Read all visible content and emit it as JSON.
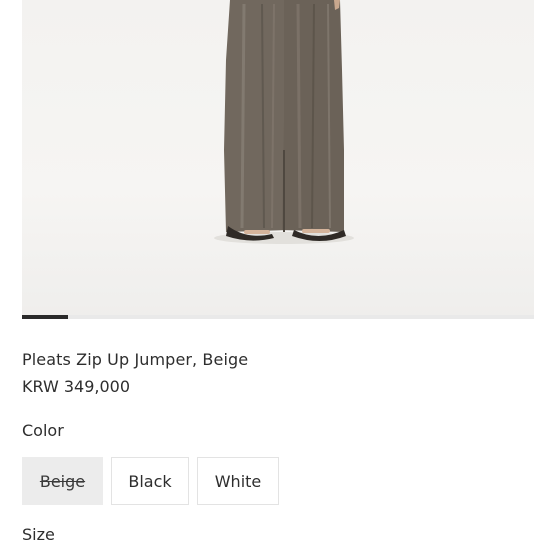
{
  "product": {
    "image_alt": "Model wearing wide pleated trousers in taupe",
    "name": "Pleats Zip Up Jumper, Beige",
    "price": "KRW 349,000"
  },
  "carousel": {
    "progress_fraction": 0.09
  },
  "color": {
    "label": "Color",
    "options": [
      {
        "label": "Beige",
        "available": false
      },
      {
        "label": "Black",
        "available": true
      },
      {
        "label": "White",
        "available": true
      }
    ]
  },
  "size": {
    "label": "Size"
  },
  "colors": {
    "garment": "#6e655b",
    "indicator": "#2a2a2a",
    "disabled_bg": "#ececec"
  }
}
